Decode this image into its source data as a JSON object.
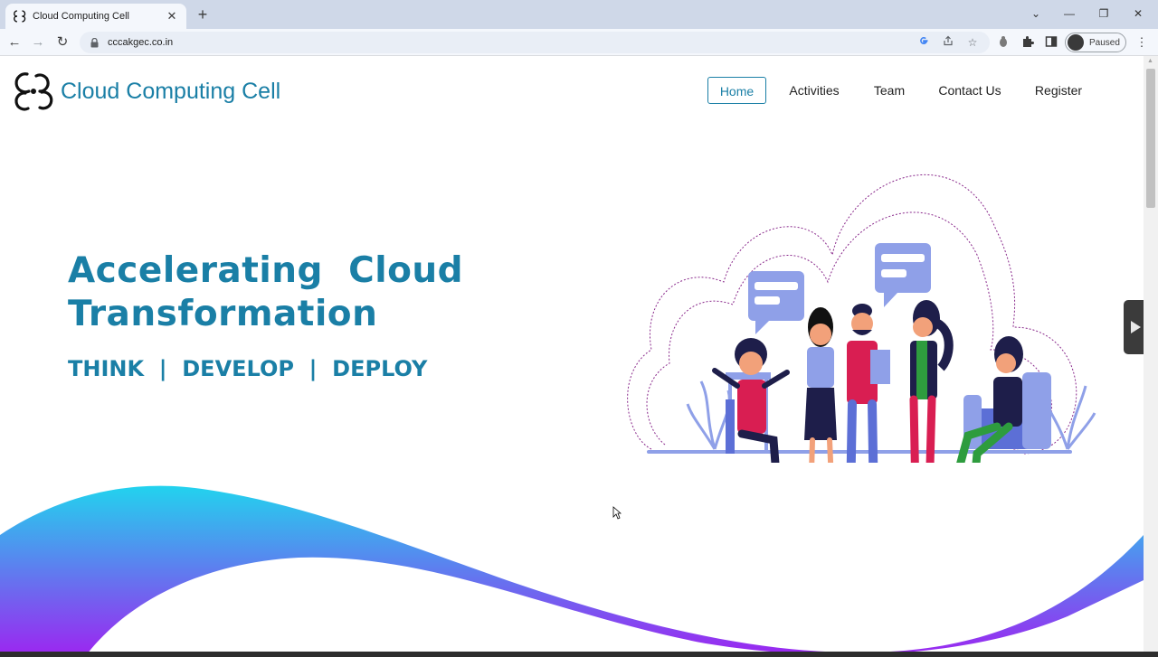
{
  "browser": {
    "tab_title": "Cloud Computing Cell",
    "tab_close": "✕",
    "new_tab": "+",
    "url": "cccakgec.co.in",
    "profile_label": "Paused",
    "back": "←",
    "forward": "→",
    "reload": "↻",
    "minimize": "—",
    "restore": "❐",
    "close": "✕",
    "tab_list": "⌄",
    "menu": "⋮"
  },
  "site": {
    "brand": "Cloud Computing Cell",
    "nav": [
      {
        "label": "Home",
        "active": true
      },
      {
        "label": "Activities",
        "active": false
      },
      {
        "label": "Team",
        "active": false
      },
      {
        "label": "Contact Us",
        "active": false
      },
      {
        "label": "Register",
        "active": false
      }
    ],
    "hero_title_line1": "Accelerating  Cloud",
    "hero_title_line2": "Transformation",
    "hero_subtitle": "THINK  |  DEVELOP  |  DEPLOY"
  },
  "colors": {
    "brand": "#1a7fa6",
    "wave_start": "#22d3ee",
    "wave_end": "#a020f0",
    "illustration_blue": "#8fa0e8",
    "illustration_red": "#d91e52"
  }
}
